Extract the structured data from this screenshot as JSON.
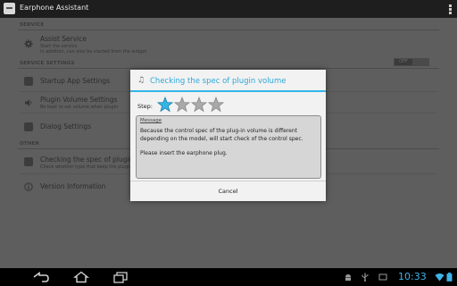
{
  "app": {
    "title": "Earphone Assistant"
  },
  "settings": {
    "section_service": "SERVICE",
    "assist": {
      "title": "Assist Service",
      "sub1": "Start the service",
      "sub2": "In addition, can also be started from the widget",
      "toggle": "OFF"
    },
    "section_service_settings": "SERVICE SETTINGS",
    "startup": {
      "title": "Startup App Settings"
    },
    "plugin": {
      "title": "Plugin Volume Settings",
      "sub": "Be kept to set volume when plugin"
    },
    "dialog_settings": {
      "title": "Dialog Settings"
    },
    "section_other": "OTHER",
    "check": {
      "title": "Checking the spec of plugin volu",
      "sub": "Check whether type that keep the plugin vol"
    },
    "version": {
      "title": "Version Information"
    }
  },
  "dialog": {
    "title": "Checking the spec of plugin volume",
    "step_label": "Step:",
    "step_current": 1,
    "step_total": 4,
    "message_title": "Message",
    "message_p1": "Because the control spec of the plug-in volume is different depending on the model, will start check of the control spec.",
    "message_p2": "Please insert the earphone plug.",
    "cancel_label": "Cancel"
  },
  "status": {
    "time": "10:33"
  },
  "colors": {
    "accent": "#33b5e5",
    "star_active": "#33b5e5",
    "star_inactive": "#a9a9a9"
  },
  "icons": [
    "app-icon",
    "overflow-icon",
    "gear-icon",
    "speaker-icon",
    "back-icon",
    "home-icon",
    "recents-icon",
    "android-icon",
    "usb-icon",
    "wifi-icon",
    "battery-icon"
  ]
}
